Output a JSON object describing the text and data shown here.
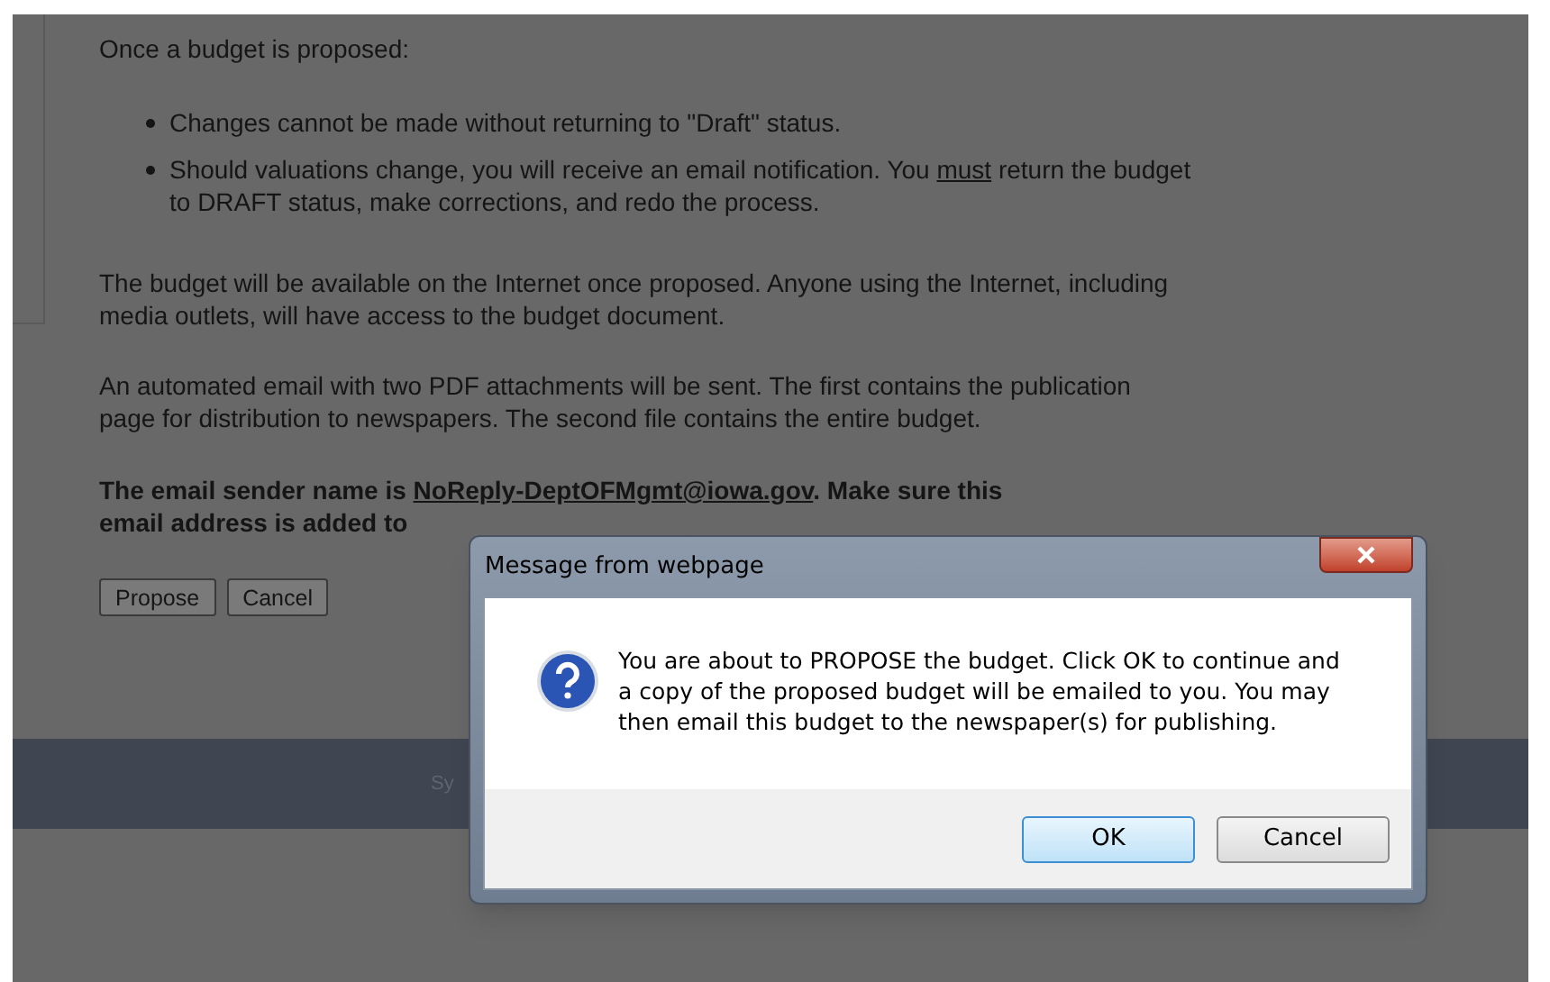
{
  "page": {
    "intro": "Once a budget is proposed:",
    "bullets": [
      {
        "before": "Changes cannot be made without returning to \"Draft\" status."
      },
      {
        "before": "Should valuations change, you will receive an email notification. You ",
        "underlined": "must",
        "after": " return the budget to DRAFT status, make corrections, and redo the process."
      }
    ],
    "paragraphs": [
      "The budget will be available on the Internet once proposed. Anyone using the Internet, including media outlets, will have access to the budget document.",
      "An automated email with two PDF attachments will be sent. The first contains the publication page for distribution to newspapers. The second file contains the entire budget."
    ],
    "notice": {
      "before": "The email sender name is ",
      "link": "NoReply-DeptOFMgmt@iowa.gov",
      "after": ". Make sure this",
      "line_2": "email address is added to"
    },
    "buttons": [
      "Propose",
      "Cancel"
    ],
    "footer_text": "Sy"
  },
  "dialog": {
    "title": "Message from webpage",
    "message": "You are about to PROPOSE the budget. Click OK to continue and a copy of the proposed budget will be emailed to you. You may then email this budget to the newspaper(s) for publishing.",
    "buttons": [
      {
        "label": "OK",
        "default": true
      },
      {
        "label": "Cancel",
        "default": false
      }
    ]
  }
}
